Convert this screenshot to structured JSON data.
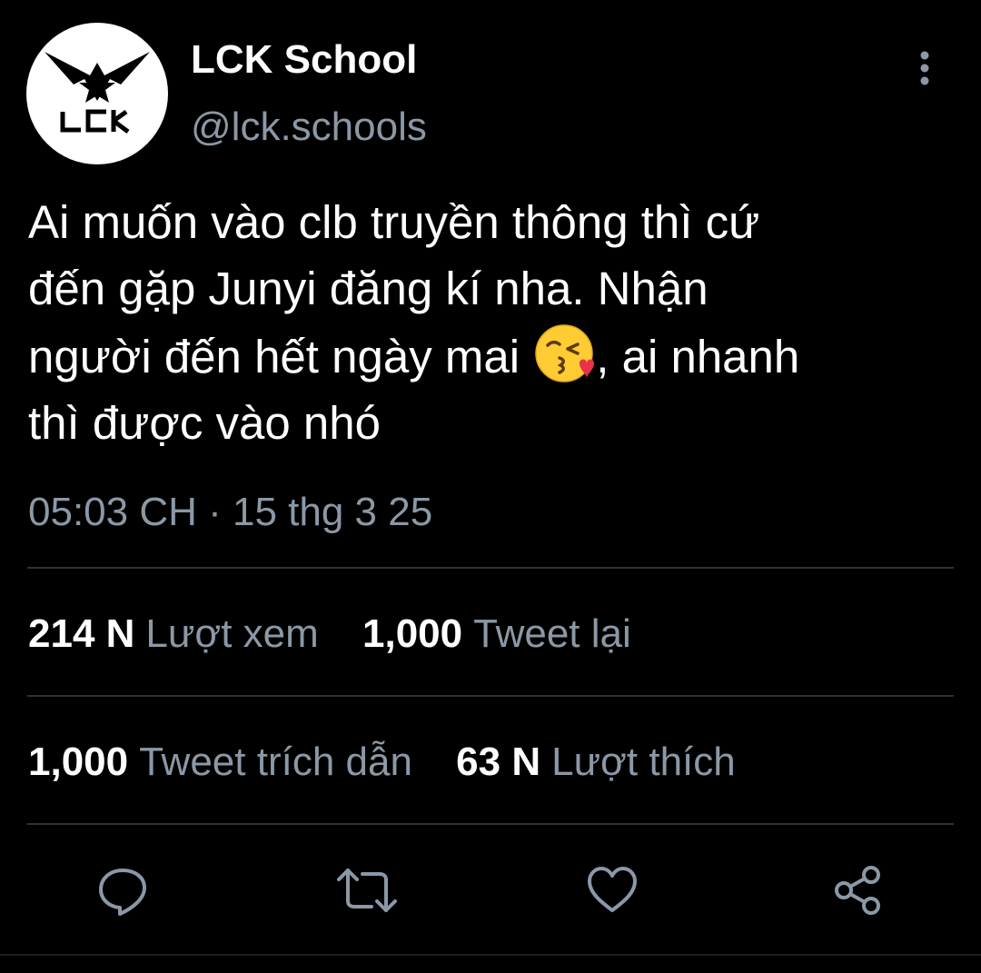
{
  "header": {
    "display_name": "LCK School",
    "handle": "@lck.schools",
    "avatar_text": "LCK"
  },
  "tweet": {
    "text_part1": "Ai muốn vào clb truyền thông thì cứ\nđến gặp Junyi đăng kí nha. Nhận\nngười đến hết ngày mai ",
    "emoji": "face-blowing-a-kiss-emoji",
    "text_part2": ", ai nhanh\nthì được vào nhó",
    "timestamp": "05:03 CH · 15 thg 3 25"
  },
  "stats": {
    "views_count": "214 N",
    "views_label": "Lượt xem",
    "retweets_count": "1,000",
    "retweets_label": "Tweet lại",
    "quotes_count": "1,000",
    "quotes_label": "Tweet trích dẫn",
    "likes_count": "63 N",
    "likes_label": "Lượt thích"
  },
  "actions": {
    "reply_icon": "comment-icon",
    "retweet_icon": "retweet-icon",
    "like_icon": "heart-icon",
    "share_icon": "share-icon",
    "icon_color": "#8b98a5"
  },
  "colors": {
    "background": "#000000",
    "primary_text": "#ffffff",
    "secondary_text": "#8b98a5",
    "divider": "#2f3336"
  }
}
